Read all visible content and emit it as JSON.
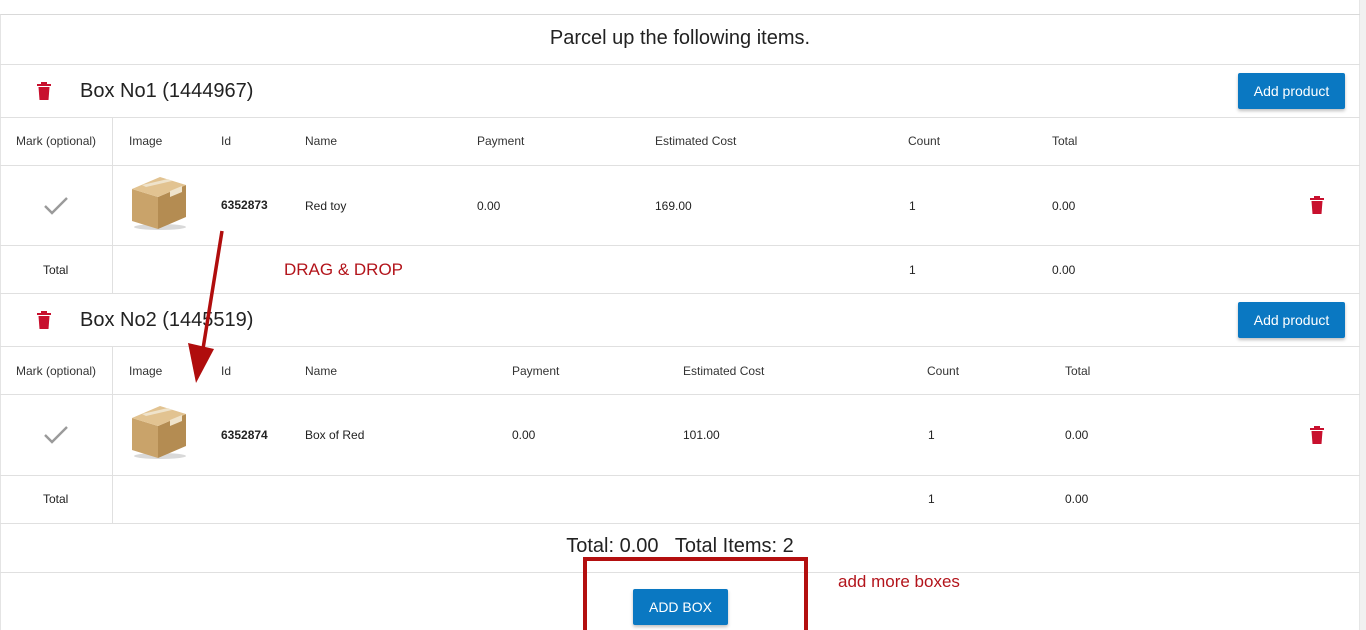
{
  "heading": "Parcel up the following items.",
  "boxes": [
    {
      "title": "Box No1 (1444967)",
      "add_label": "Add product",
      "columns": [
        "Mark (optional)",
        "Image",
        "Id",
        "Name",
        "Payment",
        "Estimated Cost",
        "Count",
        "Total"
      ],
      "row": {
        "id": "6352873",
        "name": "Red toy",
        "payment": "0.00",
        "estimated_cost": "169.00",
        "count": "1",
        "total": "0.00"
      },
      "footer": {
        "label": "Total",
        "count": "1",
        "total": "0.00"
      }
    },
    {
      "title": "Box No2 (1445519)",
      "add_label": "Add product",
      "columns": [
        "Mark (optional)",
        "Image",
        "Id",
        "Name",
        "Payment",
        "Estimated Cost",
        "Count",
        "Total"
      ],
      "row": {
        "id": "6352874",
        "name": "Box of Red",
        "payment": "0.00",
        "estimated_cost": "101.00",
        "count": "1",
        "total": "0.00"
      },
      "footer": {
        "label": "Total",
        "count": "1",
        "total": "0.00"
      }
    }
  ],
  "summary": "Total: 0.00   Total Items: 2",
  "add_box_label": "ADD BOX",
  "annotations": {
    "drag": "DRAG & DROP",
    "more": "add more boxes"
  },
  "colors": {
    "primary": "#0a78c2",
    "danger": "#c8102e",
    "annotation": "#b3141b"
  },
  "icons": [
    "trash-icon",
    "check-icon",
    "box-image-icon"
  ]
}
